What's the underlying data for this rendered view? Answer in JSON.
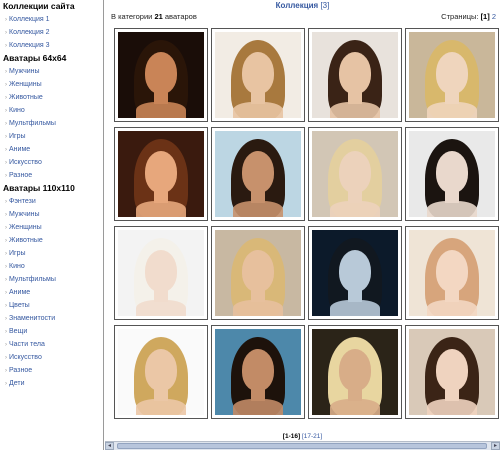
{
  "sidebar": {
    "sections": [
      {
        "title": "Коллекции сайта",
        "items": [
          "Коллекция 1",
          "Коллекция 2",
          "Коллекция 3"
        ]
      },
      {
        "title": "Аватары 64x64",
        "items": [
          "Мужчины",
          "Женщины",
          "Животные",
          "Кино",
          "Мультфильмы",
          "Игры",
          "Аниме",
          "Искусство",
          "Разное"
        ]
      },
      {
        "title": "Аватары 110x110",
        "items": [
          "Фэнтези",
          "Мужчины",
          "Женщины",
          "Животные",
          "Игры",
          "Кино",
          "Мультфильмы",
          "Аниме",
          "Цветы",
          "Знаменитости",
          "Вещи",
          "Части тела",
          "Искусство",
          "Разное",
          "Дети"
        ]
      }
    ]
  },
  "main": {
    "collection_name": "Коллекция",
    "collection_count": "[3]",
    "category_prefix": "В категории",
    "category_count": "21",
    "category_suffix": "аватаров",
    "pages_label": "Страницы:",
    "pages_current": "[1]",
    "pages_next": "2",
    "pager_current": "[1-16]",
    "pager_next": "[17-21]"
  },
  "avatars": [
    {
      "bg": "#1a0d08",
      "hair": "#2a1508",
      "skin": "#c98457"
    },
    {
      "bg": "#f2ece4",
      "hair": "#a8793e",
      "skin": "#e8c4a2"
    },
    {
      "bg": "#e8e2dc",
      "hair": "#3a2316",
      "skin": "#e6c3a4"
    },
    {
      "bg": "#c9b79a",
      "hair": "#d8b86c",
      "skin": "#efd5bd"
    },
    {
      "bg": "#3a1a0e",
      "hair": "#6b3216",
      "skin": "#e7a77c"
    },
    {
      "bg": "#bcd6e3",
      "hair": "#2a1a10",
      "skin": "#c7916c"
    },
    {
      "bg": "#d2c6b5",
      "hair": "#e3cf9f",
      "skin": "#ecd2bb"
    },
    {
      "bg": "#e9e9e9",
      "hair": "#1b1410",
      "skin": "#e9d8cc"
    },
    {
      "bg": "#f3f3f3",
      "hair": "#f4f1ea",
      "skin": "#f1dccd"
    },
    {
      "bg": "#c8b8a2",
      "hair": "#d9b878",
      "skin": "#e7c09d"
    },
    {
      "bg": "#0c1a2a",
      "hair": "#111820",
      "skin": "#b8c9d8"
    },
    {
      "bg": "#efe4d6",
      "hair": "#d7a57c",
      "skin": "#f3d7c2"
    },
    {
      "bg": "#fafafa",
      "hair": "#cfa85e",
      "skin": "#ebc7a6"
    },
    {
      "bg": "#4d88aa",
      "hair": "#1d120b",
      "skin": "#c28b66"
    },
    {
      "bg": "#2b2418",
      "hair": "#e8d6a0",
      "skin": "#d8ad88"
    },
    {
      "bg": "#d9c9b8",
      "hair": "#3b2416",
      "skin": "#efd3bf"
    }
  ]
}
